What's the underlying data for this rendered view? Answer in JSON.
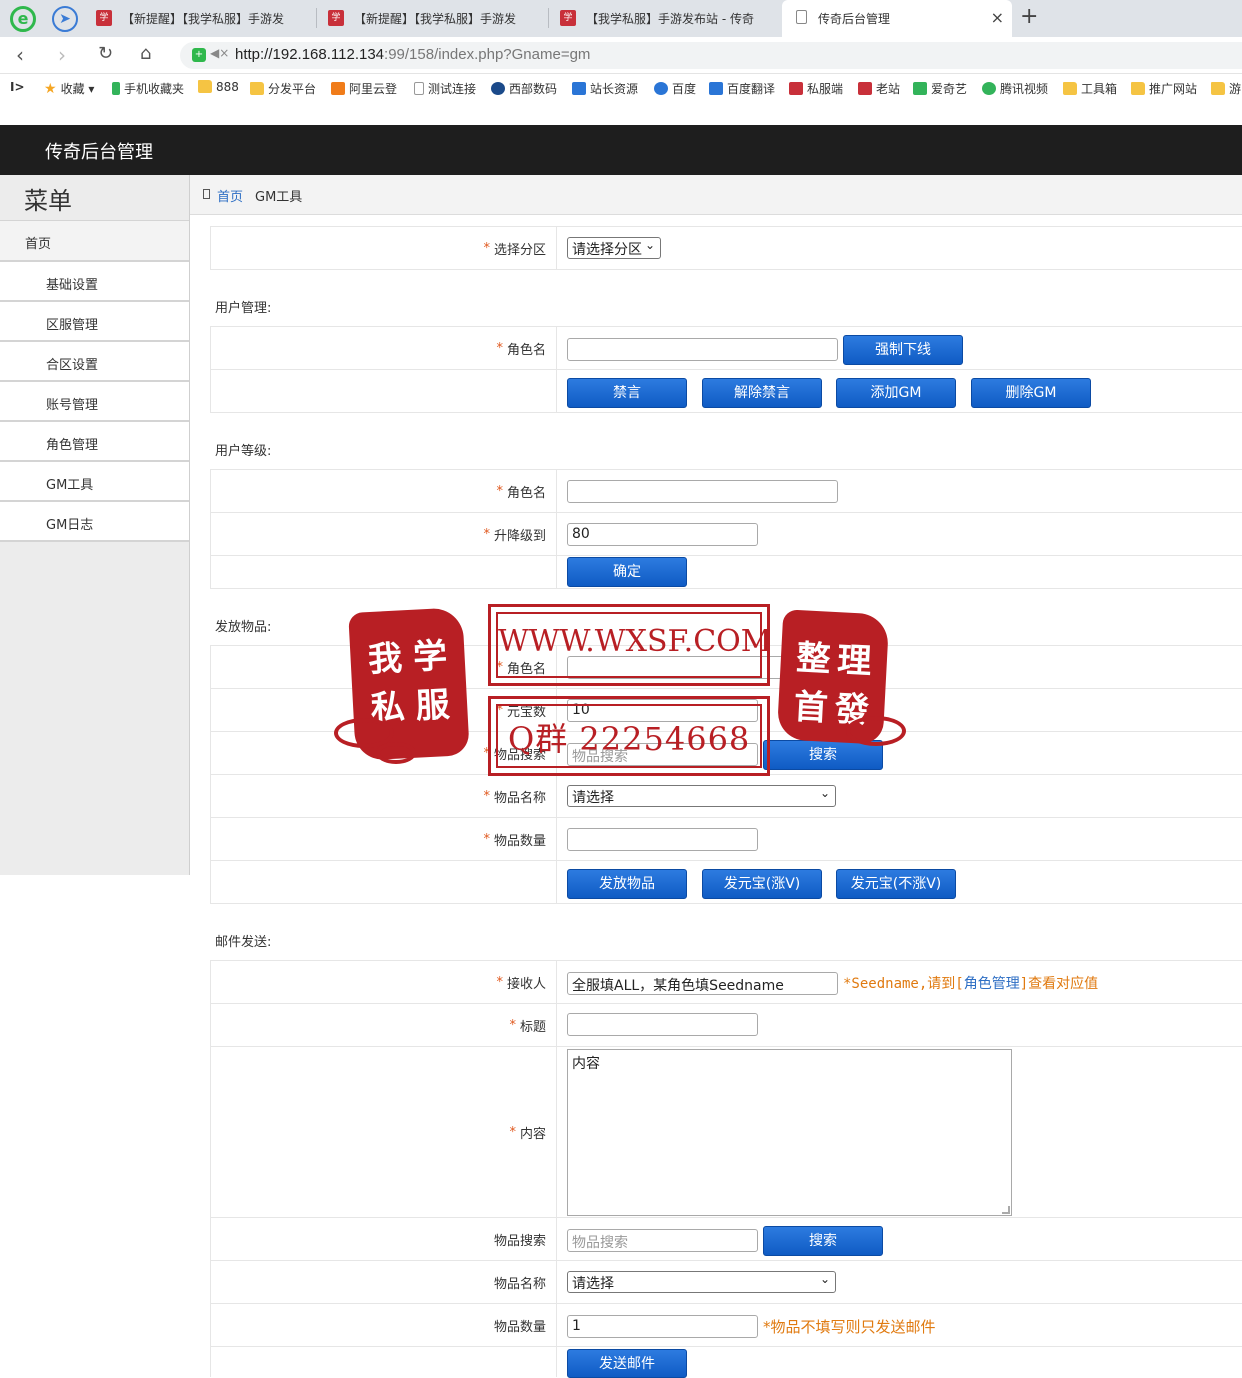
{
  "browser": {
    "tabs": [
      {
        "title": "【新提醒】【我学私服】手游发"
      },
      {
        "title": "【新提醒】【我学私服】手游发"
      },
      {
        "title": "【我学私服】手游发布站 - 传奇"
      },
      {
        "title": "传奇后台管理"
      }
    ],
    "url_host": "http://192.168.112.134",
    "url_rest": ":99/158/index.php?Gname=gm",
    "bookmarks": [
      "收藏",
      "手机收藏夹",
      "888",
      "分发平台",
      "阿里云登",
      "测试连接",
      "西部数码",
      "站长资源",
      "百度",
      "百度翻译",
      "私服端",
      "老站",
      "爱奇艺",
      "腾讯视频",
      "工具箱",
      "推广网站",
      "游"
    ]
  },
  "app": {
    "title": "传奇后台管理"
  },
  "sidebar": {
    "title": "菜单",
    "home": "首页",
    "items": [
      "基础设置",
      "区服管理",
      "合区设置",
      "账号管理",
      "角色管理",
      "GM工具",
      "GM日志"
    ]
  },
  "breadcrumb": {
    "home": "首页",
    "current": "GM工具"
  },
  "form": {
    "server": {
      "label": "选择分区",
      "selected": "请选择分区"
    },
    "user_mgmt": {
      "section": "用户管理:",
      "role_label": "角色名",
      "kick_button": "强制下线",
      "buttons": [
        "禁言",
        "解除禁言",
        "添加GM",
        "删除GM"
      ]
    },
    "user_level": {
      "section": "用户等级:",
      "role_label": "角色名",
      "level_label": "升降级到",
      "level_value": "80",
      "confirm_button": "确定"
    },
    "items": {
      "section": "发放物品:",
      "role_label": "角色名",
      "ingot_label": "元宝数",
      "ingot_value": "10",
      "search_label": "物品搜索",
      "search_placeholder": "物品搜索",
      "search_button": "搜索",
      "name_label": "物品名称",
      "name_selected": "请选择",
      "qty_label": "物品数量",
      "buttons": [
        "发放物品",
        "发元宝(涨V)",
        "发元宝(不涨V)"
      ]
    },
    "mail": {
      "section": "邮件发送:",
      "recipient_label": "接收人",
      "recipient_value": "全服填ALL，某角色填Seedname",
      "recipient_hint_pre": "*Seedname,请到[",
      "recipient_hint_link": "角色管理",
      "recipient_hint_post": "]查看对应值",
      "subject_label": "标题",
      "content_label": "内容",
      "content_value": "内容",
      "search_label": "物品搜索",
      "search_placeholder": "物品搜索",
      "search_button": "搜索",
      "name_label": "物品名称",
      "name_selected": "请选择",
      "qty_label": "物品数量",
      "qty_value": "1",
      "qty_hint": "*物品不填写则只发送邮件",
      "send_button": "发送邮件"
    }
  },
  "watermark": {
    "left_seal": [
      "我",
      "学",
      "私",
      "服"
    ],
    "right_seal": [
      "整",
      "理",
      "首",
      "發"
    ],
    "site": "WWW.WXSF.COM",
    "qq": "Q群 22254668"
  },
  "colors": {
    "header_bg": "#1e1e1e",
    "button_blue": "#1465cf",
    "required": "#e0581e",
    "hint": "#e07a10",
    "link": "#2d6ec4",
    "watermark": "#b81f24"
  }
}
